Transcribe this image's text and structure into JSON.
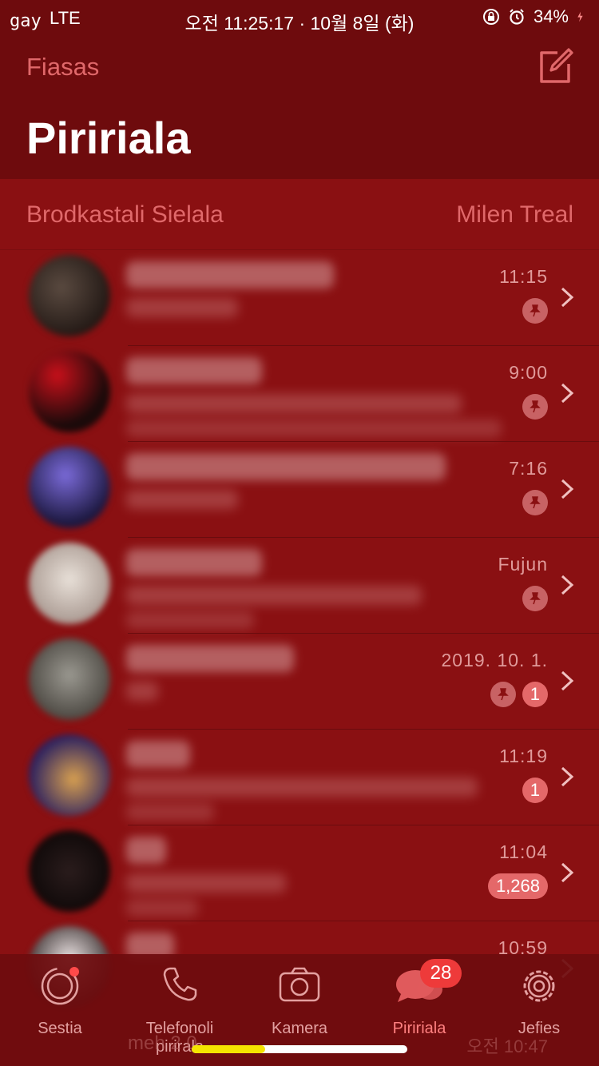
{
  "status_bar": {
    "carrier": "gay",
    "network": "LTE",
    "datetime": "오전 11:25:17 · 10월 8일 (화)",
    "battery": "34%"
  },
  "header": {
    "edit_label": "Fiasas",
    "title": "Piririala"
  },
  "subheader": {
    "left_label": "Brodkastali Sielala",
    "right_label": "Milen Treal"
  },
  "chats": [
    {
      "time": "11:15",
      "pinned": true,
      "unread": ""
    },
    {
      "time": "9:00",
      "pinned": true,
      "unread": ""
    },
    {
      "time": "7:16",
      "pinned": true,
      "unread": ""
    },
    {
      "time": "Fujun",
      "pinned": true,
      "unread": ""
    },
    {
      "time": "2019. 10. 1.",
      "pinned": true,
      "unread": "1"
    },
    {
      "time": "11:19",
      "pinned": false,
      "unread": "1"
    },
    {
      "time": "11:04",
      "pinned": false,
      "unread": "1,268"
    },
    {
      "time": "10:59",
      "pinned": false,
      "unread": ""
    }
  ],
  "tabs": [
    {
      "label": "Sestia",
      "icon": "status-icon"
    },
    {
      "label": "Telefonoli pirirala",
      "icon": "phone-icon"
    },
    {
      "label": "Kamera",
      "icon": "camera-icon"
    },
    {
      "label": "Piririala",
      "icon": "chats-icon",
      "badge": "28"
    },
    {
      "label": "Jefies",
      "icon": "settings-icon"
    }
  ],
  "ghost_row": {
    "name": "meh 2.0",
    "time": "오전 10:47"
  },
  "colors": {
    "background": "#8a1012",
    "header": "#6e0b0d",
    "accent": "#e0686a",
    "badge": "#ee3a3a"
  }
}
